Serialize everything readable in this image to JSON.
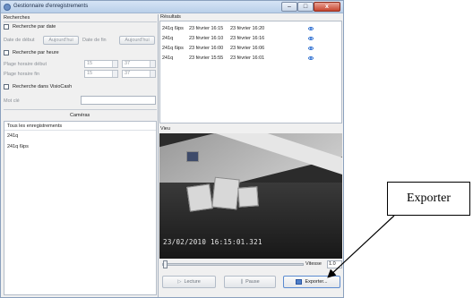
{
  "window": {
    "title": "Gestionnaire d'enregistrements",
    "minimize": "–",
    "maximize": "□",
    "close": "x"
  },
  "searches": {
    "group_label": "Recherches",
    "by_date": {
      "label": "Recherche par date",
      "start_label": "Date de début",
      "start_button": "Aujourd'hui",
      "end_label": "Date de fin",
      "end_button": "Aujourd'hui"
    },
    "by_time": {
      "label": "Recherche par heure",
      "start_label": "Plage horaire début",
      "end_label": "Plage horaire fin",
      "start_hour": "15",
      "start_minute": "37",
      "end_hour": "15",
      "end_minute": "37"
    },
    "visiocash": {
      "label": "Recherche dans VisioCash",
      "keyword_label": "Mot clé",
      "keyword_value": ""
    }
  },
  "cameras": {
    "label": "Caméras",
    "items": [
      "Tous les enregistrements",
      "241q",
      "241q 6ips"
    ]
  },
  "results": {
    "label": "Résultats",
    "rows": [
      {
        "camera": "241q 6ips",
        "start": "23 février 16:15",
        "end": "23 février 16:20"
      },
      {
        "camera": "241q",
        "start": "23 février 16:10",
        "end": "23 février 16:16"
      },
      {
        "camera": "241q 6ips",
        "start": "23 février 16:00",
        "end": "23 février 16:06"
      },
      {
        "camera": "241q",
        "start": "23 février 15:55",
        "end": "23 février 16:01"
      }
    ]
  },
  "view": {
    "label": "Vieu",
    "timestamp": "23/02/2010 16:15:01.321",
    "speed_label": "Vitesse",
    "speed_value": "1.0",
    "playback_position": 0.0
  },
  "controls": {
    "play": "Lecture",
    "pause": "Pause",
    "export": "Exporter..."
  },
  "annotation": {
    "text": "Exporter"
  },
  "colors": {
    "accent": "#2e6fd1",
    "title_bar": "#c6d8ee",
    "close": "#c7452f"
  }
}
